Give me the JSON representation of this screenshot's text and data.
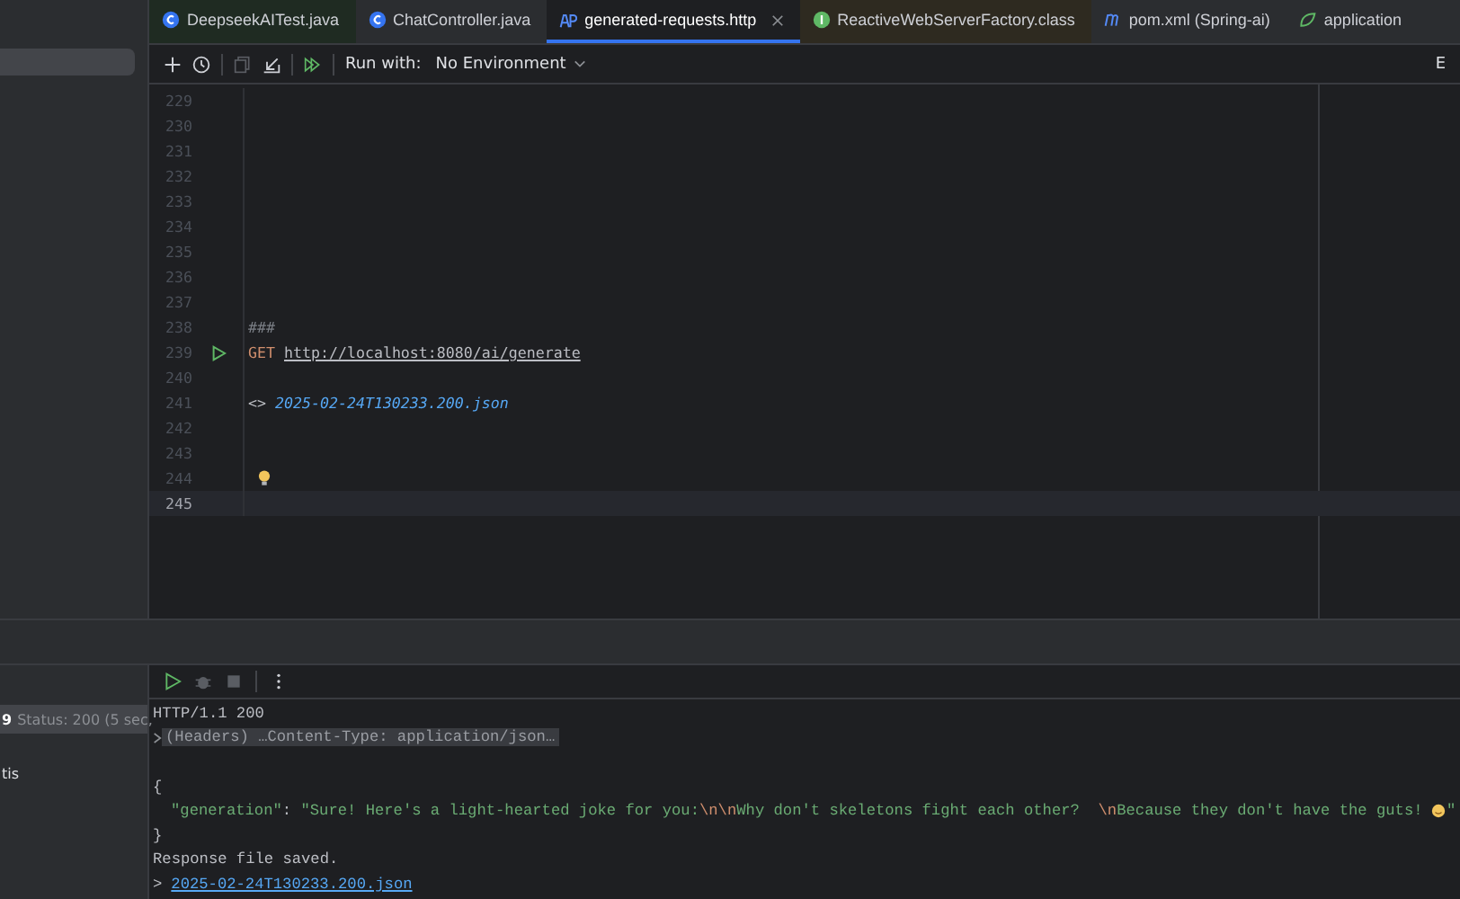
{
  "tabs": [
    {
      "label": "DeepseekAITest.java",
      "kind": "class",
      "color": "#1f2b22",
      "selected": false,
      "closable": false
    },
    {
      "label": "ChatController.java",
      "kind": "class",
      "color": "#2b2d30",
      "selected": false,
      "closable": false
    },
    {
      "label": "generated-requests.http",
      "kind": "api",
      "color": "#1e1f22",
      "selected": true,
      "closable": true
    },
    {
      "label": "ReactiveWebServerFactory.class",
      "kind": "interface",
      "color": "#2e2a20",
      "selected": false,
      "closable": false
    },
    {
      "label": "pom.xml (Spring-ai)",
      "kind": "maven",
      "color": "#2b2d30",
      "selected": false,
      "closable": false
    },
    {
      "label": "application",
      "kind": "config",
      "color": "#2b2d30",
      "selected": false,
      "closable": false
    }
  ],
  "toolbar": {
    "run_with_label": "Run with:",
    "environment": "No Environment",
    "right_text": "E"
  },
  "editor": {
    "lines": [
      {
        "number": "229",
        "kind": "blank",
        "current": false
      },
      {
        "number": "230",
        "kind": "blank",
        "current": false
      },
      {
        "number": "231",
        "kind": "blank",
        "current": false
      },
      {
        "number": "232",
        "kind": "blank",
        "current": false
      },
      {
        "number": "233",
        "kind": "blank",
        "current": false
      },
      {
        "number": "234",
        "kind": "blank",
        "current": false
      },
      {
        "number": "235",
        "kind": "blank",
        "current": false
      },
      {
        "number": "236",
        "kind": "blank",
        "current": false
      },
      {
        "number": "237",
        "kind": "blank",
        "current": false
      },
      {
        "number": "238",
        "kind": "separator",
        "text": "###",
        "current": false
      },
      {
        "number": "239",
        "kind": "request",
        "method": "GET",
        "url": "http://localhost:8080/ai/generate",
        "current": false
      },
      {
        "number": "240",
        "kind": "blank",
        "current": false
      },
      {
        "number": "241",
        "kind": "response_ref",
        "marker": "<>",
        "file": "2025-02-24T130233.200.json",
        "current": false
      },
      {
        "number": "242",
        "kind": "blank",
        "current": false
      },
      {
        "number": "243",
        "kind": "blank",
        "current": false
      },
      {
        "number": "244",
        "kind": "hint",
        "current": false
      },
      {
        "number": "245",
        "kind": "blank",
        "current": true
      }
    ]
  },
  "services": {
    "items": [
      {
        "badge": "9",
        "text": "Status: 200 (5 sec,",
        "selected": true
      },
      {
        "text": "tis",
        "selected": false
      }
    ]
  },
  "output": {
    "lines": [
      {
        "kind": "text",
        "text": "HTTP/1.1 200"
      },
      {
        "kind": "folded",
        "text": "(Headers) …Content-Type: application/json…"
      },
      {
        "kind": "blank"
      },
      {
        "kind": "text",
        "text": "{"
      },
      {
        "kind": "json_pair",
        "key": "\"generation\"",
        "colon": ": ",
        "parts": [
          {
            "kind": "string",
            "text": "\"Sure! Here's a light-hearted joke for you:"
          },
          {
            "kind": "escape",
            "text": "\\n\\n"
          },
          {
            "kind": "string",
            "text": "Why don't skeletons fight each other?  "
          },
          {
            "kind": "escape",
            "text": "\\n"
          },
          {
            "kind": "string",
            "text": "Because they don't have the guts! "
          },
          {
            "kind": "emoji"
          },
          {
            "kind": "string",
            "text": "\""
          }
        ]
      },
      {
        "kind": "text",
        "text": "}"
      },
      {
        "kind": "text",
        "text": "Response file saved."
      },
      {
        "kind": "link",
        "marker": ">",
        "text": "2025-02-24T130233.200.json"
      }
    ]
  }
}
